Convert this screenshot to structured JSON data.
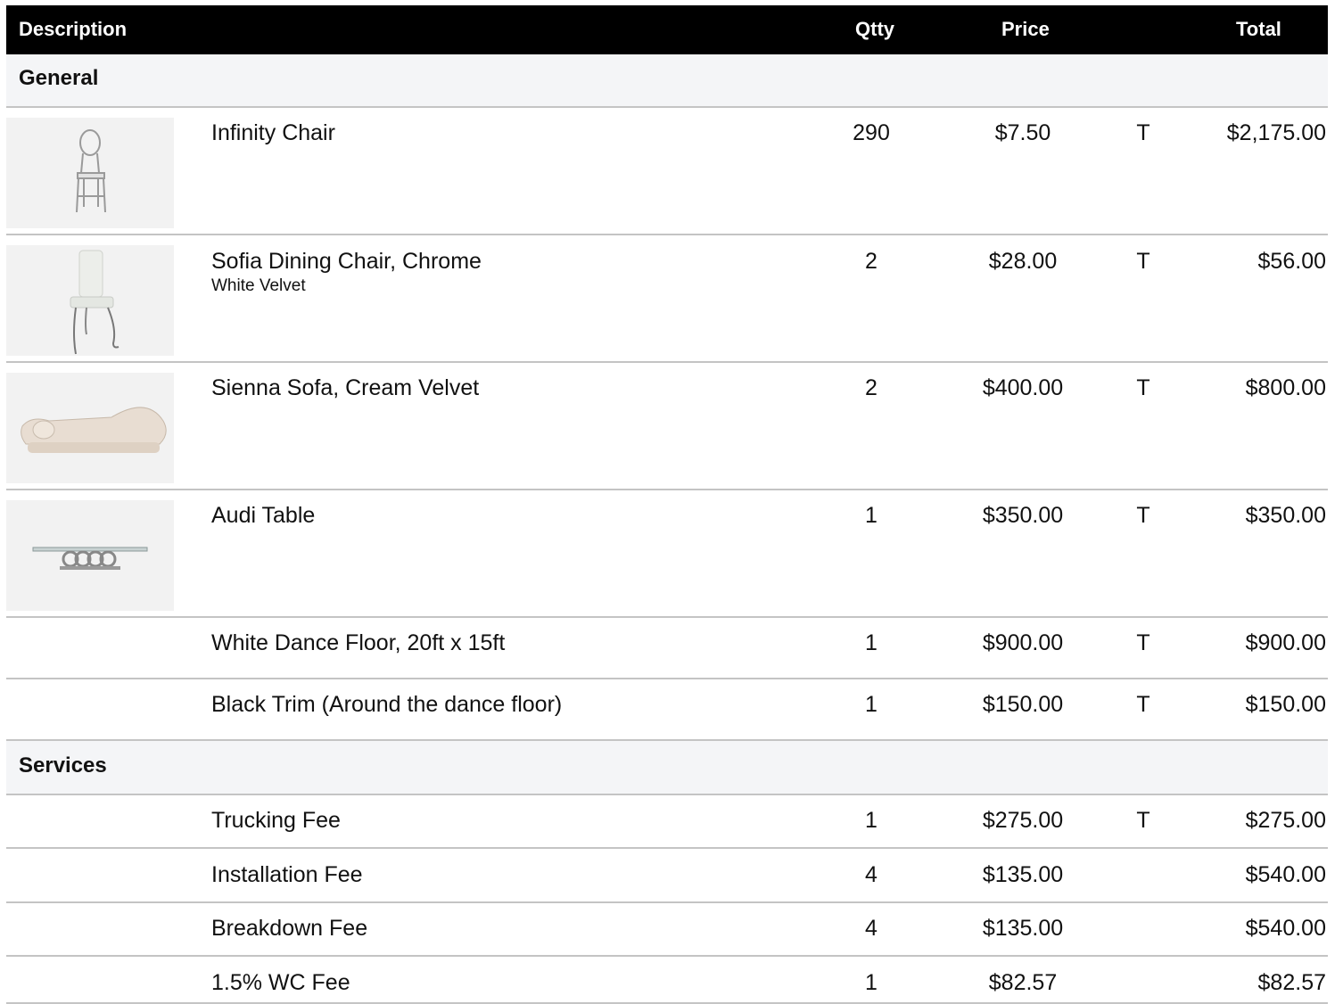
{
  "header": {
    "description": "Description",
    "qty": "Qtty",
    "price": "Price",
    "total": "Total"
  },
  "sections": [
    {
      "name": "General",
      "items": [
        {
          "description": "Infinity Chair",
          "sub": "",
          "qty": "290",
          "price": "$7.50",
          "tax": "T",
          "total": "$2,175.00",
          "image": "chair-image"
        },
        {
          "description": "Sofia Dining Chair, Chrome",
          "sub": "White Velvet",
          "qty": "2",
          "price": "$28.00",
          "tax": "T",
          "total": "$56.00",
          "image": "dining-chair-image"
        },
        {
          "description": "Sienna Sofa, Cream Velvet",
          "sub": "",
          "qty": "2",
          "price": "$400.00",
          "tax": "T",
          "total": "$800.00",
          "image": "sofa-image"
        },
        {
          "description": "Audi Table",
          "sub": "",
          "qty": "1",
          "price": "$350.00",
          "tax": "T",
          "total": "$350.00",
          "image": "table-image"
        },
        {
          "description": "White Dance Floor, 20ft x 15ft",
          "sub": "",
          "qty": "1",
          "price": "$900.00",
          "tax": "T",
          "total": "$900.00",
          "image": ""
        },
        {
          "description": "Black Trim (Around the dance floor)",
          "sub": "",
          "qty": "1",
          "price": "$150.00",
          "tax": "T",
          "total": "$150.00",
          "image": ""
        }
      ]
    },
    {
      "name": "Services",
      "items": [
        {
          "description": "Trucking Fee",
          "sub": "",
          "qty": "1",
          "price": "$275.00",
          "tax": "T",
          "total": "$275.00",
          "image": ""
        },
        {
          "description": "Installation Fee",
          "sub": "",
          "qty": "4",
          "price": "$135.00",
          "tax": "",
          "total": "$540.00",
          "image": ""
        },
        {
          "description": "Breakdown Fee",
          "sub": "",
          "qty": "4",
          "price": "$135.00",
          "tax": "",
          "total": "$540.00",
          "image": ""
        },
        {
          "description": "1.5% WC Fee",
          "sub": "",
          "qty": "1",
          "price": "$82.57",
          "tax": "",
          "total": "$82.57",
          "image": ""
        }
      ]
    }
  ]
}
